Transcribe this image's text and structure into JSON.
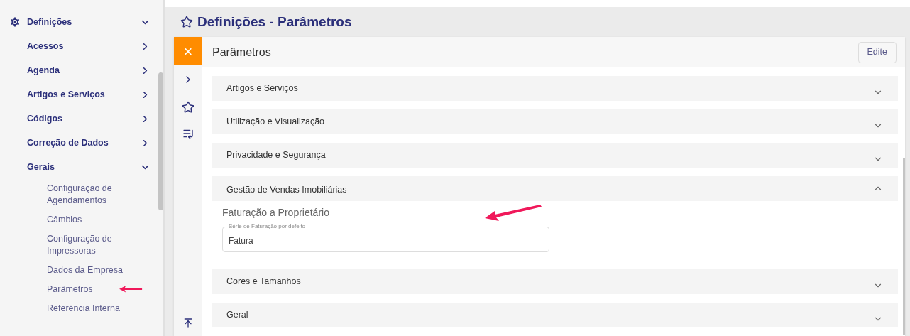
{
  "sidebar": {
    "items": [
      {
        "label": "Definições",
        "expanded": true,
        "children": [
          {
            "label": "Acessos",
            "expanded": false
          },
          {
            "label": "Agenda",
            "expanded": false
          },
          {
            "label": "Artigos e Serviços",
            "expanded": false
          },
          {
            "label": "Códigos",
            "expanded": false
          },
          {
            "label": "Correção de Dados",
            "expanded": false
          },
          {
            "label": "Gerais",
            "expanded": true,
            "children": [
              {
                "label": "Configuração de Agendamentos"
              },
              {
                "label": "Câmbios"
              },
              {
                "label": "Configuração de Impressoras"
              },
              {
                "label": "Dados da Empresa"
              },
              {
                "label": "Parâmetros"
              },
              {
                "label": "Referência Interna"
              }
            ]
          }
        ]
      }
    ]
  },
  "page": {
    "title": "Definições - Parâmetros"
  },
  "panel": {
    "close": "×",
    "title": "Parâmetros",
    "edit_button": "Edite",
    "sections": [
      {
        "title": "Artigos e Serviços",
        "expanded": false
      },
      {
        "title": "Utilização e Visualização",
        "expanded": false
      },
      {
        "title": "Privacidade e Segurança",
        "expanded": false
      },
      {
        "title": "Gestão de Vendas Imobiliárias",
        "expanded": true,
        "subsection": "Faturação a Proprietário",
        "field": {
          "label": "Série de Faturação por defeito",
          "value": "Fatura"
        }
      },
      {
        "title": "Cores e Tamanhos",
        "expanded": false
      },
      {
        "title": "Geral",
        "expanded": false
      }
    ]
  }
}
